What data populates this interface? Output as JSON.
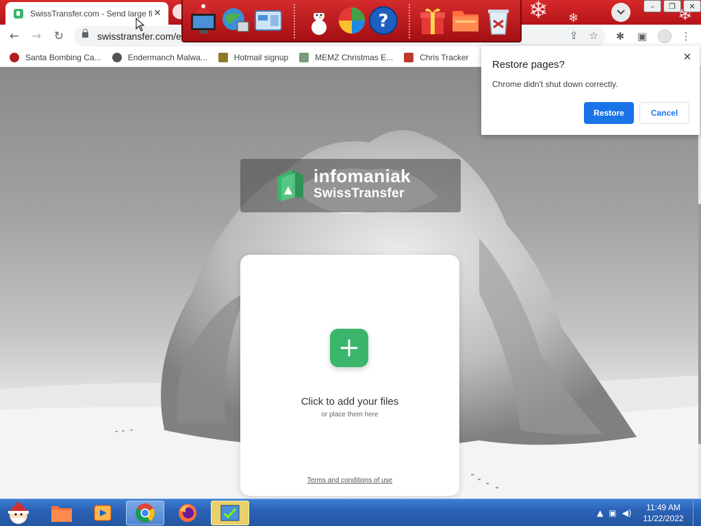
{
  "browser": {
    "tab": {
      "title": "SwissTransfer.com - Send large fi",
      "close_glyph": "✕"
    },
    "url": "swisstransfer.com/e",
    "bookmarks": [
      {
        "label": "Santa Bombing Ca...",
        "icon": "santa-icon",
        "color": "#b02020"
      },
      {
        "label": "Endermanch Malwa...",
        "icon": "raccoon-icon",
        "color": "#555555"
      },
      {
        "label": "Hotmail signup",
        "icon": "man-icon",
        "color": "#8a7a2a"
      },
      {
        "label": "MEMZ Christmas E...",
        "icon": "memz-icon",
        "color": "#7a9a7a"
      },
      {
        "label": "Chris Tracker",
        "icon": "tracker-icon",
        "color": "#c0392b"
      }
    ]
  },
  "restore_dialog": {
    "title": "Restore pages?",
    "message": "Chrome didn't shut down correctly.",
    "restore_label": "Restore",
    "cancel_label": "Cancel"
  },
  "page": {
    "brand_name": "infomaniak",
    "product_name": "SwissTransfer",
    "add_title": "Click to add your files",
    "add_subtitle": "or place them here",
    "terms_link": "Terms and conditions of use",
    "accent_color": "#3ab56b"
  },
  "taskbar": {
    "time": "11:49 AM",
    "date": "11/22/2022"
  },
  "colors": {
    "chrome_theme_red": "#c9161b",
    "primary_blue": "#1a73e8",
    "taskbar_blue": "#2b62b7"
  }
}
